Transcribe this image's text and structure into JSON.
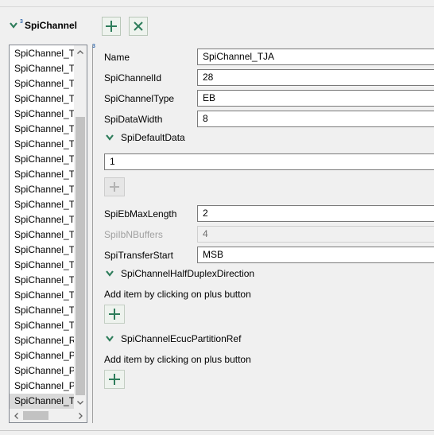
{
  "header": {
    "title": "SpiChannel",
    "badge": "3"
  },
  "list": {
    "items": [
      "SpiChannel_Tx",
      "SpiChannel_Tx",
      "SpiChannel_Tx",
      "SpiChannel_Tx",
      "SpiChannel_Tx",
      "SpiChannel_Tx",
      "SpiChannel_Tx",
      "SpiChannel_Tx",
      "SpiChannel_Tx",
      "SpiChannel_Tx",
      "SpiChannel_Tx",
      "SpiChannel_Tx",
      "SpiChannel_Tx",
      "SpiChannel_Tx",
      "SpiChannel_Tx",
      "SpiChannel_Tx",
      "SpiChannel_Tx",
      "SpiChannel_Tx",
      "SpiChannel_Tx",
      "SpiChannel_Rx",
      "SpiChannel_PS",
      "SpiChannel_PS",
      "SpiChannel_PS",
      "SpiChannel_TJA"
    ],
    "selected_index": 23
  },
  "splitter_badge": "3",
  "form": {
    "name_label": "Name",
    "name_value": "SpiChannel_TJA",
    "id_label": "SpiChannelId",
    "id_value": "28",
    "type_label": "SpiChannelType",
    "type_value": "EB",
    "width_label": "SpiDataWidth",
    "width_value": "8",
    "default_section": "SpiDefaultData",
    "default_value": "1",
    "ebmax_label": "SpiEbMaxLength",
    "ebmax_value": "2",
    "ibn_label": "SpiIbNBuffers",
    "ibn_value": "4",
    "transfer_label": "SpiTransferStart",
    "transfer_value": "MSB",
    "halfduplex_section": "SpiChannelHalfDuplexDirection",
    "halfduplex_hint": "Add item by clicking on plus button",
    "ecuc_section": "SpiChannelEcucPartitionRef",
    "ecuc_hint": "Add item by clicking on plus button"
  },
  "colors": {
    "accent": "#2e7d5b",
    "disabled_text": "#a0a0a0",
    "selection": "#d9d9d9"
  }
}
